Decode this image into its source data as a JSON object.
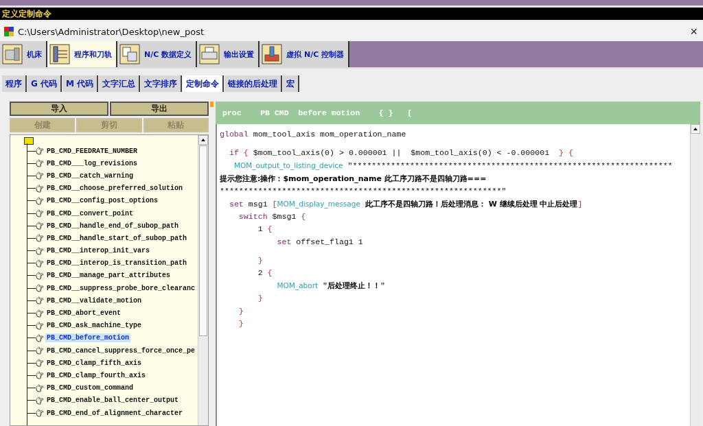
{
  "title_bar": {
    "title": "定义定制命令"
  },
  "window": {
    "path": "C:\\Users\\Administrator\\Desktop\\new_post",
    "close": "×"
  },
  "main_tabs": [
    {
      "label": "机床",
      "selected": false
    },
    {
      "label": "程序和刀轨",
      "selected": true
    },
    {
      "label": "N/C 数据定义",
      "selected": false
    },
    {
      "label": "输出设置",
      "selected": false
    },
    {
      "label": "虚拟 N/C 控制器",
      "selected": false
    }
  ],
  "sub_tabs": [
    {
      "label": "程序",
      "selected": false
    },
    {
      "label": "G 代码",
      "selected": false
    },
    {
      "label": "M 代码",
      "selected": false
    },
    {
      "label": "文字汇总",
      "selected": false
    },
    {
      "label": "文字排序",
      "selected": false
    },
    {
      "label": "定制命令",
      "selected": true
    },
    {
      "label": "链接的后处理",
      "selected": false
    },
    {
      "label": "宏",
      "selected": false
    }
  ],
  "file_buttons": [
    {
      "label": "导入",
      "disabled": false
    },
    {
      "label": "导出",
      "disabled": false
    }
  ],
  "edit_buttons": [
    {
      "label": "创建",
      "disabled": true
    },
    {
      "label": "剪切",
      "disabled": true
    },
    {
      "label": "粘贴",
      "disabled": true
    }
  ],
  "tree": {
    "items": [
      {
        "label": "PB_CMD_FEEDRATE_NUMBER",
        "selected": false
      },
      {
        "label": "PB_CMD___log_revisions",
        "selected": false
      },
      {
        "label": "PB_CMD__catch_warning",
        "selected": false
      },
      {
        "label": "PB_CMD__choose_preferred_solution",
        "selected": false
      },
      {
        "label": "PB_CMD__config_post_options",
        "selected": false
      },
      {
        "label": "PB_CMD__convert_point",
        "selected": false
      },
      {
        "label": "PB_CMD__handle_end_of_subop_path",
        "selected": false
      },
      {
        "label": "PB_CMD__handle_start_of_subop_path",
        "selected": false
      },
      {
        "label": "PB_CMD__interop_init_vars",
        "selected": false
      },
      {
        "label": "PB_CMD__interop_is_transition_path",
        "selected": false
      },
      {
        "label": "PB_CMD__manage_part_attributes",
        "selected": false
      },
      {
        "label": "PB_CMD__suppress_probe_bore_clearanc",
        "selected": false
      },
      {
        "label": "PB_CMD__validate_motion",
        "selected": false
      },
      {
        "label": "PB_CMD_abort_event",
        "selected": false
      },
      {
        "label": "PB_CMD_ask_machine_type",
        "selected": false
      },
      {
        "label": "PB_CMD_before_motion",
        "selected": true
      },
      {
        "label": "PB_CMD_cancel_suppress_force_once_pe",
        "selected": false
      },
      {
        "label": "PB_CMD_clamp_fifth_axis",
        "selected": false
      },
      {
        "label": "PB_CMD_clamp_fourth_axis",
        "selected": false
      },
      {
        "label": "PB_CMD_custom_command",
        "selected": false
      },
      {
        "label": "PB_CMD_enable_ball_center_output",
        "selected": false
      },
      {
        "label": "PB_CMD_end_of_alignment_character",
        "selected": false
      }
    ]
  },
  "editor": {
    "header": "proc    PB CMD  before motion    { }   [",
    "lines": [
      {
        "tokens": [
          {
            "kind": "keyword",
            "text": "global"
          },
          {
            "kind": "plain",
            "text": " mom_tool_axis mom_operation_name"
          }
        ]
      },
      {
        "space_before": true,
        "tokens": [
          {
            "kind": "keyword",
            "text": "  if"
          },
          {
            "kind": "brace",
            "text": " { "
          },
          {
            "kind": "plain",
            "text": "$mom_tool_axis(0) > 0.000001 ||  $mom_tool_axis(0) < -0.000001 "
          },
          {
            "kind": "brace",
            "text": " } {"
          }
        ]
      },
      {
        "tokens": [
          {
            "kind": "command",
            "text": "   MOM_output_to_listing_device"
          },
          {
            "kind": "plain",
            "text": " \"*******************************************************************"
          }
        ]
      },
      {
        "tokens": [
          {
            "kind": "bold",
            "text": "提示您注意:操作：$mom_operation_name 此工序刀路不是四轴刀路==="
          }
        ]
      },
      {
        "tokens": [
          {
            "kind": "plain",
            "text": "***********************************************************\""
          }
        ]
      },
      {
        "tokens": [
          {
            "kind": "keyword",
            "text": "  set"
          },
          {
            "kind": "plain",
            "text": " msg1 "
          },
          {
            "kind": "brace",
            "text": "["
          },
          {
            "kind": "command",
            "text": "MOM_display_message"
          },
          {
            "kind": "bold",
            "text": " 此工序不是四轴刀路！后处理消息： W 继续后处理 中止后处理"
          },
          {
            "kind": "brace",
            "text": "]"
          }
        ]
      },
      {
        "tokens": [
          {
            "kind": "keyword",
            "text": "    switch"
          },
          {
            "kind": "plain",
            "text": " $msg1 "
          },
          {
            "kind": "brace",
            "text": "{"
          }
        ]
      },
      {
        "tokens": [
          {
            "kind": "plain",
            "text": "        1 "
          },
          {
            "kind": "brace",
            "text": "{"
          }
        ]
      },
      {
        "tokens": [
          {
            "kind": "keyword",
            "text": "            set"
          },
          {
            "kind": "plain",
            "text": " offset_flag1 1"
          }
        ]
      },
      {
        "space_before": true,
        "tokens": [
          {
            "kind": "brace",
            "text": "        }"
          }
        ]
      },
      {
        "tokens": [
          {
            "kind": "plain",
            "text": "        2 "
          },
          {
            "kind": "brace",
            "text": "{"
          }
        ]
      },
      {
        "tokens": [
          {
            "kind": "command",
            "text": "            MOM_abort"
          },
          {
            "kind": "plain",
            "text": " \""
          },
          {
            "kind": "bold",
            "text": "后处理终止！！"
          },
          {
            "kind": "plain",
            "text": "\""
          }
        ]
      },
      {
        "tokens": [
          {
            "kind": "brace",
            "text": "        }"
          }
        ]
      },
      {
        "tokens": [
          {
            "kind": "brace",
            "text": "    }"
          }
        ]
      },
      {
        "tokens": [
          {
            "kind": "brace",
            "text": "    }"
          }
        ]
      }
    ]
  }
}
